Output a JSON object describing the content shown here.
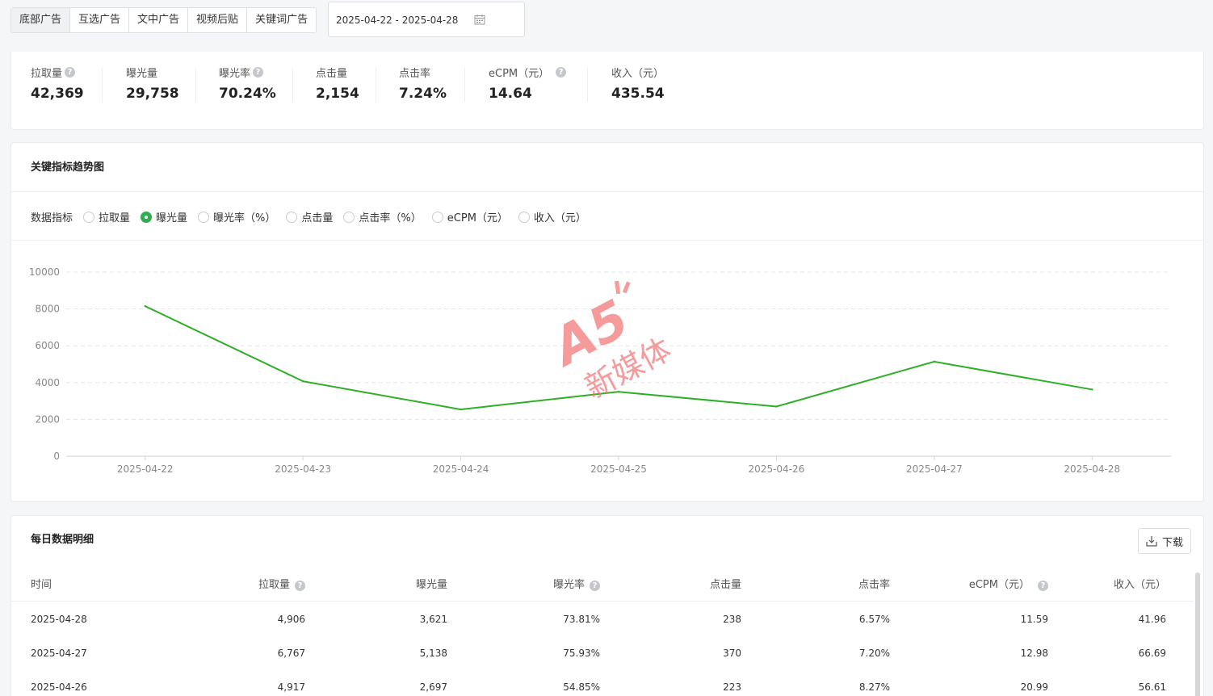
{
  "tabs": [
    "底部广告",
    "互选广告",
    "文中广告",
    "视频后贴",
    "关键词广告"
  ],
  "date_range": "2025-04-22 - 2025-04-28",
  "stats": [
    {
      "label": "拉取量",
      "value": "42,369",
      "help": true
    },
    {
      "label": "曝光量",
      "value": "29,758",
      "help": false
    },
    {
      "label": "曝光率",
      "value": "70.24%",
      "help": true
    },
    {
      "label": "点击量",
      "value": "2,154",
      "help": false
    },
    {
      "label": "点击率",
      "value": "7.24%",
      "help": false
    },
    {
      "label": "eCPM（元）",
      "value": "14.64",
      "help": true
    },
    {
      "label": "收入（元）",
      "value": "435.54",
      "help": false
    }
  ],
  "trend": {
    "title": "关键指标趋势图",
    "metric_label": "数据指标",
    "options": [
      "拉取量",
      "曝光量",
      "曝光率（%）",
      "点击量",
      "点击率（%）",
      "eCPM（元）",
      "收入（元）"
    ],
    "selected": "曝光量"
  },
  "chart_data": {
    "type": "line",
    "x": [
      "2025-04-22",
      "2025-04-23",
      "2025-04-24",
      "2025-04-25",
      "2025-04-26",
      "2025-04-27",
      "2025-04-28"
    ],
    "series": [
      {
        "values": [
          8150,
          4070,
          2540,
          3500,
          2697,
          5138,
          3621
        ]
      }
    ],
    "ylim": [
      0,
      10000
    ],
    "yticks": [
      "10000",
      "8000",
      "6000",
      "4000",
      "2000",
      "0"
    ],
    "grid": true,
    "line_color": "#2fae28"
  },
  "watermark": {
    "text": "新媒体",
    "logo": "A5"
  },
  "table": {
    "title": "每日数据明细",
    "download_label": "下载",
    "columns": [
      "时间",
      "拉取量",
      "曝光量",
      "曝光率",
      "点击量",
      "点击率",
      "eCPM（元）",
      "收入（元）"
    ],
    "rows": [
      [
        "2025-04-28",
        "4,906",
        "3,621",
        "73.81%",
        "238",
        "6.57%",
        "11.59",
        "41.96"
      ],
      [
        "2025-04-27",
        "6,767",
        "5,138",
        "75.93%",
        "370",
        "7.20%",
        "12.98",
        "66.69"
      ],
      [
        "2025-04-26",
        "4,917",
        "2,697",
        "54.85%",
        "223",
        "8.27%",
        "20.99",
        "56.61"
      ]
    ]
  },
  "colors": {
    "accent": "#2fae4c",
    "line": "#2fae28",
    "watermark": "#f26a6a"
  }
}
